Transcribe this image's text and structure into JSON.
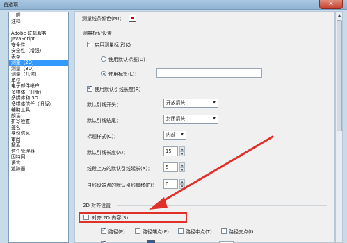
{
  "window": {
    "title": "首选项",
    "close_glyph": "✕"
  },
  "sidebar": {
    "items": [
      "一般",
      "注释",
      "",
      "Adobe 联机服务",
      "JavaScript",
      "安全性",
      "安全性（增强）",
      "表单",
      "测量（2D）",
      "测量（3D）",
      "测量（几何）",
      "单位",
      "电子邮件帐户",
      "多媒体（旧版）",
      "多媒体和 3D",
      "多媒体信任（旧版）",
      "辅助工具",
      "朗读",
      "拼写检查",
      "签名",
      "身份信息",
      "审阅",
      "搜索",
      "信任管理器",
      "因特网",
      "语言",
      "追踪器"
    ],
    "selected_index": 8
  },
  "panel": {
    "line_color_label": "测量线条颜色(M)：",
    "line_color": "#d10000",
    "markup_section": "测量标记设置",
    "enable_markup_label": "启用测量标记(K)",
    "default_label_radio": "使用默认标签(D)",
    "use_label_radio": "使用标签(L)：",
    "use_label_value": "",
    "leader_checkbox": "使用默认引线长度(R)",
    "leader_start_label": "默认引线开头：",
    "leader_start_value": "开放箭头",
    "leader_end_label": "默认引线结尾：",
    "leader_end_value": "封闭箭头",
    "caption_style_label": "标题样式(C)：",
    "caption_style_value": "内部",
    "leader_length_label": "默认引线长度(A)：",
    "leader_length_value": "15",
    "leader_ext_label": "线段上方的默认引线延长(X)：",
    "leader_ext_value": "5",
    "leader_offset_label": "自线段端点的默认引线偏移(F)：",
    "leader_offset_value": "0",
    "snap_section": "2D 对齐设置",
    "snap_2d_label": "对齐 2D 内容(S)",
    "snap_path_label": "路径(P)",
    "snap_endpoint_label": "路径端点(E)",
    "snap_midpoint_label": "路径中点(T)",
    "snap_intersection_label": "路径交点(I)"
  },
  "annotation": {
    "accent": "#e0302a"
  }
}
